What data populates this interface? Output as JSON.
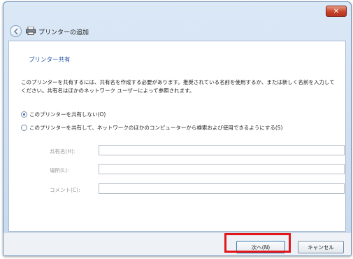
{
  "window": {
    "title": "プリンターの追加",
    "close_glyph": "✕"
  },
  "page": {
    "section_title": "プリンター共有",
    "description": "このプリンターを共有するには、共有名を作成する必要があります。推奨されている名前を使用するか、または新しく名前を入力してください。共有名はほかのネットワーク ユーザーによって参照されます。"
  },
  "options": [
    {
      "label": "このプリンターを共有しない(O)",
      "selected": true
    },
    {
      "label": "このプリンターを共有して、ネットワークのほかのコンピューターから検索および使用できるようにする(S)",
      "selected": false
    }
  ],
  "fields": [
    {
      "label": "共有名(H):",
      "value": ""
    },
    {
      "label": "場所(L):",
      "value": ""
    },
    {
      "label": "コメント(C):",
      "value": ""
    }
  ],
  "buttons": {
    "next": "次へ(N)",
    "cancel": "キャンセル"
  },
  "colors": {
    "highlight": "#e0161c",
    "section_title": "#1f4fa0"
  }
}
